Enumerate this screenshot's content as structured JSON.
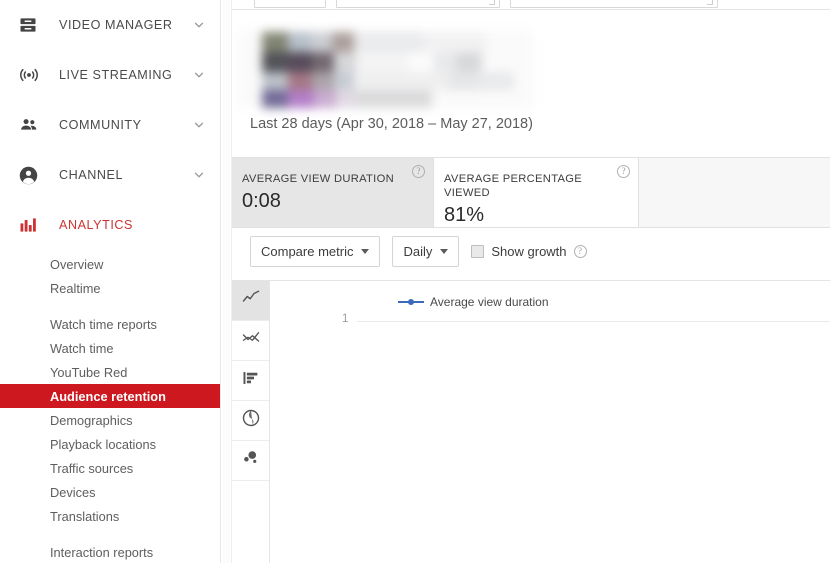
{
  "sidebar": {
    "main_items": [
      {
        "label": "VIDEO MANAGER",
        "icon": "video-manager-icon",
        "chevron": "chevron-down-icon"
      },
      {
        "label": "LIVE STREAMING",
        "icon": "live-streaming-icon",
        "chevron": "chevron-down-icon"
      },
      {
        "label": "COMMUNITY",
        "icon": "community-icon",
        "chevron": "chevron-down-icon"
      },
      {
        "label": "CHANNEL",
        "icon": "channel-icon",
        "chevron": "chevron-down-icon"
      },
      {
        "label": "ANALYTICS",
        "icon": "analytics-bar-chart-icon",
        "chevron": ""
      }
    ],
    "sub_groups": [
      {
        "items": [
          {
            "label": "Overview",
            "active": false
          },
          {
            "label": "Realtime",
            "active": false
          }
        ]
      },
      {
        "items": [
          {
            "label": "Watch time reports",
            "active": false
          },
          {
            "label": "Watch time",
            "active": false
          },
          {
            "label": "YouTube Red",
            "active": false
          },
          {
            "label": "Audience retention",
            "active": true
          },
          {
            "label": "Demographics",
            "active": false
          },
          {
            "label": "Playback locations",
            "active": false
          },
          {
            "label": "Traffic sources",
            "active": false
          },
          {
            "label": "Devices",
            "active": false
          },
          {
            "label": "Translations",
            "active": false
          }
        ]
      },
      {
        "items": [
          {
            "label": "Interaction reports",
            "active": false
          }
        ]
      }
    ],
    "active_color": "#cc181e",
    "analytics_color": "#cc3333"
  },
  "content": {
    "date_range": "Last 28 days (Apr 30, 2018 – May 27, 2018)",
    "cards": [
      {
        "title": "AVERAGE VIEW DURATION",
        "value": "0:08",
        "selected": true,
        "help": "?"
      },
      {
        "title": "AVERAGE PERCENTAGE VIEWED",
        "value": "81%",
        "selected": false,
        "help": "?"
      }
    ],
    "toolbar": {
      "compare_metric_label": "Compare metric",
      "interval_label": "Daily",
      "show_growth_label": "Show growth",
      "show_growth_checked": false,
      "help": "?"
    },
    "viz_rail": [
      {
        "icon": "line-chart-icon",
        "active": true
      },
      {
        "icon": "multi-line-chart-icon",
        "active": false
      },
      {
        "icon": "horizontal-bar-chart-icon",
        "active": false
      },
      {
        "icon": "geo-map-icon",
        "active": false
      },
      {
        "icon": "bubble-chart-icon",
        "active": false
      }
    ]
  },
  "chart_data": {
    "type": "line",
    "title": "",
    "xlabel": "",
    "ylabel": "",
    "legend": [
      {
        "name": "Average view duration",
        "color": "#3a6bbf"
      }
    ],
    "legend_position": "top",
    "grid": true,
    "yticks": [
      "1"
    ],
    "ylim": [
      0,
      1
    ],
    "x": [],
    "series": [
      {
        "name": "Average view duration",
        "values": []
      }
    ]
  }
}
